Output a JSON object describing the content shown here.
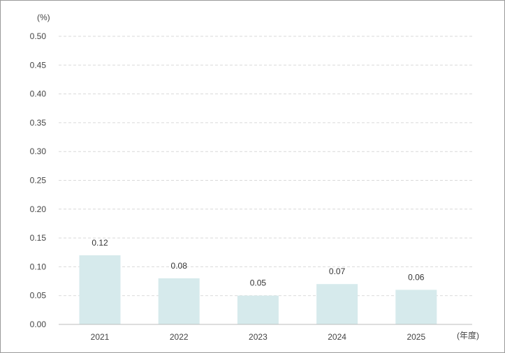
{
  "chart_data": {
    "type": "bar",
    "categories": [
      "2021",
      "2022",
      "2023",
      "2024",
      "2025"
    ],
    "values": [
      0.12,
      0.08,
      0.05,
      0.07,
      0.06
    ],
    "data_labels": [
      "0.12",
      "0.08",
      "0.05",
      "0.07",
      "0.06"
    ],
    "y_unit_label": "(%)",
    "x_unit_label": "(年度)",
    "ylim": [
      0,
      0.5
    ],
    "yticks": [
      "0.00",
      "0.05",
      "0.10",
      "0.15",
      "0.20",
      "0.25",
      "0.30",
      "0.35",
      "0.40",
      "0.45",
      "0.50"
    ],
    "grid": true,
    "legend": "none",
    "bar_color": "#d6eaec",
    "grid_color": "#d9d9d9"
  }
}
